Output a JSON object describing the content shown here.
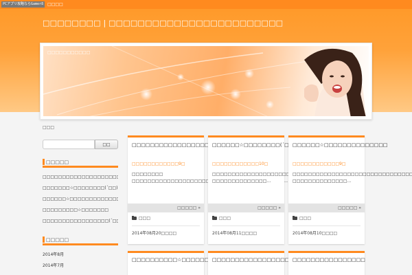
{
  "top": {
    "tagline": "PCアプリ攻略ならGamer8",
    "link": "□□□□"
  },
  "header": {
    "site_title": "□□□□□□□□ | □□□□□□□□□□□□□□□□□□□□□□□□"
  },
  "banner": {
    "title": "□□□□□□□□□□□"
  },
  "breadcrumb": "□□□",
  "sidebar": {
    "search_placeholder": "",
    "search_button": "□□",
    "recent_title": "□□□□□",
    "recent_posts": [
      "□□□□□□□□□□□□□□□□□□□□□□□□□□□(▽^*)",
      "□□□□□□□☆□□□□□□□□(´□□)",
      "□□□□□□☆□□□□□□□□□□□□□□",
      "□□□□□□□□□☆□□□□□□□",
      "□□□□□□□□□□□□□□□□□(´□□)"
    ],
    "archive_title": "□□□□□",
    "archives": [
      "2014年8月",
      "2014年7月"
    ]
  },
  "posts": [
    {
      "title": "□□□□□□□□□□□□□□□□□□□□□□□□□□□(▽^*)",
      "comments": "□□□□□□□□□□□□9□",
      "excerpt": "□□□□□□□□ □□□□□□□□□□□□□□□□□□□□□□□□□□□□□□□□□□□□□□□…",
      "more": "□□□□□ »",
      "category": "□□□",
      "date": "2014年08月20□□□□"
    },
    {
      "title": "□□□□□□☆□□□□□□□□(´□□)",
      "comments": "□□□□□□□□□□□□10□",
      "excerpt": "□□□□□□□□□□□□□□□□□□□□□□□□□□□□□□□□□ □□□□□□□□□□□□□□…",
      "more": "□□□□□ »",
      "category": "□□□",
      "date": "2014年08月11□□□□"
    },
    {
      "title": "□□□□□□☆□□□□□□□□□□□□□□",
      "comments": "□□□□□□□□□□□□9□",
      "excerpt": "□□□□□□□□□□□□□□□□□□□□□□□□□□□□□□□□□ □□□□□□□□□□□□□□…",
      "more": "□□□□□ »",
      "category": "□□□",
      "date": "2014年08月10□□□□"
    }
  ],
  "posts_row2": [
    {
      "title": "□□□□□□□□□□☆□□□□□□□"
    },
    {
      "title": "□□□□□□□□□□□□□□□□□(´□□)"
    },
    {
      "title": "□□□□□□□□□□□□□□□□"
    }
  ],
  "colors": {
    "accent": "#ff8a1f",
    "header_top": "#ff9a2a",
    "header_bottom": "#ffc985"
  }
}
